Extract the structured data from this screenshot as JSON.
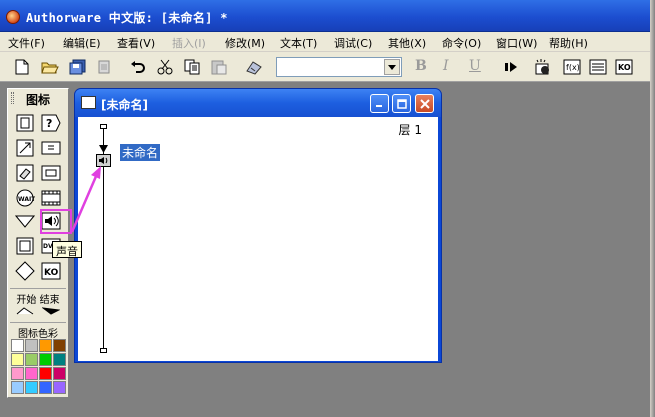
{
  "app": {
    "title": "Authorware 中文版: [未命名] *"
  },
  "menu": [
    {
      "label": "文件(F)",
      "disabled": false
    },
    {
      "label": "编辑(E)",
      "disabled": false
    },
    {
      "label": "查看(V)",
      "disabled": false
    },
    {
      "label": "插入(I)",
      "disabled": true
    },
    {
      "label": "修改(M)",
      "disabled": false
    },
    {
      "label": "文本(T)",
      "disabled": false
    },
    {
      "label": "调试(C)",
      "disabled": false
    },
    {
      "label": "其他(X)",
      "disabled": false
    },
    {
      "label": "命令(O)",
      "disabled": false
    },
    {
      "label": "窗口(W)",
      "disabled": false
    },
    {
      "label": "帮助(H)",
      "disabled": false
    }
  ],
  "toolbar": {
    "buttons": [
      "new-file-icon",
      "open-file-icon",
      "save-all-icon",
      "import-icon",
      "undo-icon",
      "cut-icon",
      "copy-icon",
      "paste-icon",
      "find-icon"
    ],
    "font_value": "",
    "bold": "B",
    "italic": "I",
    "underline": "U",
    "right_buttons": [
      "run-icon",
      "control-panel-icon",
      "functions-icon",
      "variables-icon",
      "knowledge-objects-icon"
    ]
  },
  "palette": {
    "title": "图标",
    "start_label": "开始",
    "end_label": "结束",
    "colors_label": "图标色彩",
    "tooltip": "声音",
    "swatches": [
      "#ffffff",
      "#c0c0c0",
      "#ff9900",
      "#804000",
      "#ffff99",
      "#99cc66",
      "#00cc00",
      "#008080",
      "#ff99cc",
      "#ff66cc",
      "#ff0000",
      "#cc0066",
      "#99ccff",
      "#33ccff",
      "#3366ff",
      "#9966ff"
    ]
  },
  "design_window": {
    "title": "[未命名]",
    "level_label": "层 1",
    "flow_icon_label": "未命名"
  },
  "colors": {
    "titlebar": "#1c4ed0",
    "highlight": "#e040e0",
    "selection": "#316ac5"
  }
}
